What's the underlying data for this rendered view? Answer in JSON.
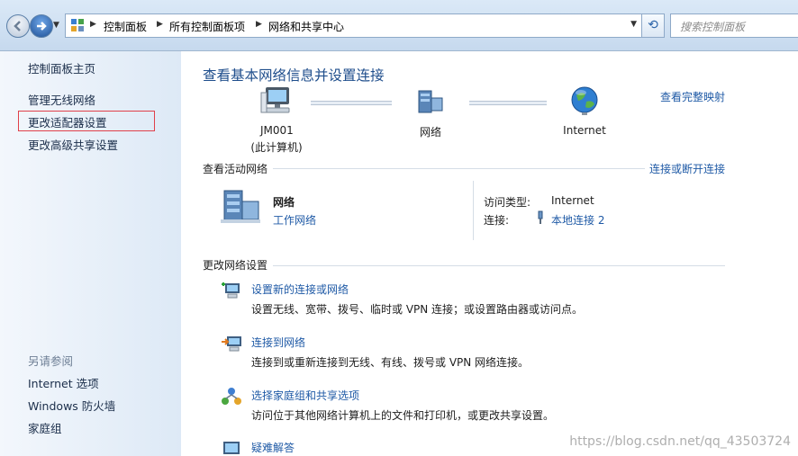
{
  "address_bar": {
    "breadcrumbs": [
      "控制面板",
      "所有控制面板项",
      "网络和共享中心"
    ],
    "search_placeholder": "搜索控制面板"
  },
  "sidebar": {
    "items": [
      "控制面板主页",
      "管理无线网络",
      "更改适配器设置",
      "更改高级共享设置"
    ],
    "see_also_title": "另请参阅",
    "see_also": [
      "Internet 选项",
      "Windows 防火墙",
      "家庭组"
    ]
  },
  "main": {
    "title": "查看基本网络信息并设置连接",
    "full_map_link": "查看完整映射",
    "map_nodes": [
      {
        "name": "JM001",
        "sub": "(此计算机)",
        "icon": "computer-icon"
      },
      {
        "name": "网络",
        "icon": "network-icon"
      },
      {
        "name": "Internet",
        "icon": "globe-icon"
      }
    ],
    "active_networks": {
      "header": "查看活动网络",
      "connect_link": "连接或断开连接",
      "network_name": "网络",
      "network_type": "工作网络",
      "access_type_label": "访问类型:",
      "access_type_value": "Internet",
      "connection_label": "连接:",
      "connection_value": "本地连接 2"
    },
    "change_settings": {
      "header": "更改网络设置",
      "tasks": [
        {
          "title": "设置新的连接或网络",
          "desc": "设置无线、宽带、拨号、临时或 VPN 连接；或设置路由器或访问点。",
          "icon": "new-connection-icon"
        },
        {
          "title": "连接到网络",
          "desc": "连接到或重新连接到无线、有线、拨号或 VPN 网络连接。",
          "icon": "connect-network-icon"
        },
        {
          "title": "选择家庭组和共享选项",
          "desc": "访问位于其他网络计算机上的文件和打印机，或更改共享设置。",
          "icon": "homegroup-icon"
        },
        {
          "title": "疑难解答",
          "icon": "troubleshoot-icon"
        }
      ]
    }
  },
  "watermark": "https://blog.csdn.net/qq_43503724"
}
